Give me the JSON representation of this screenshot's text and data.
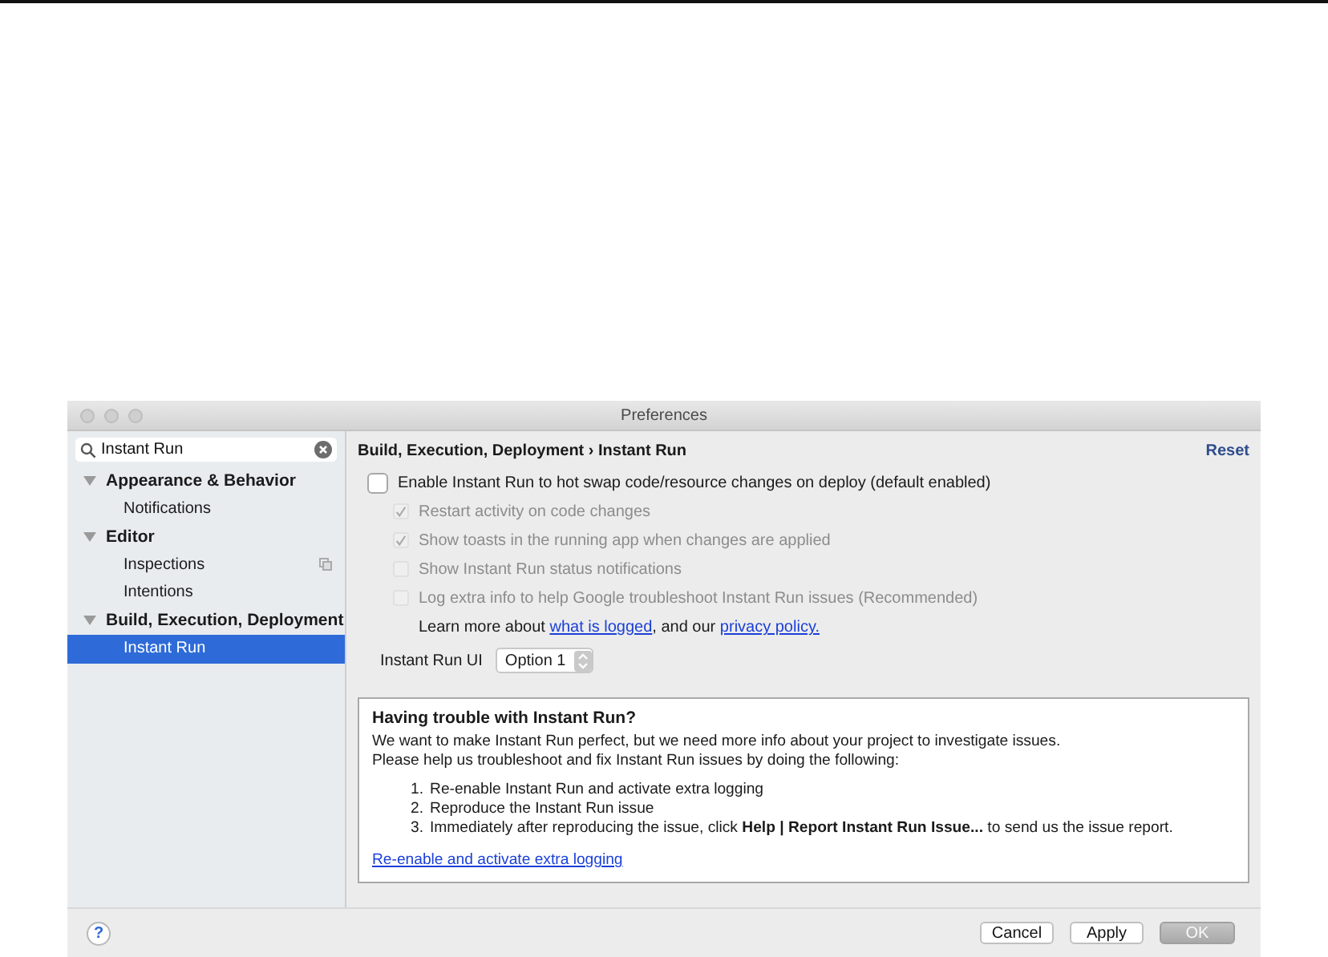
{
  "window": {
    "title": "Preferences"
  },
  "search": {
    "value": "Instant Run"
  },
  "sidebar": {
    "items": [
      {
        "label": "Appearance & Behavior",
        "expanded": true,
        "selected": false,
        "children": [
          {
            "label": "Notifications",
            "selected": false,
            "badge": false
          }
        ]
      },
      {
        "label": "Editor",
        "expanded": true,
        "selected": false,
        "children": [
          {
            "label": "Inspections",
            "selected": false,
            "badge": true
          },
          {
            "label": "Intentions",
            "selected": false,
            "badge": false
          }
        ]
      },
      {
        "label": "Build, Execution, Deployment",
        "expanded": true,
        "selected": false,
        "children": [
          {
            "label": "Instant Run",
            "selected": true,
            "badge": false
          }
        ]
      }
    ]
  },
  "breadcrumb": "Build, Execution, Deployment › Instant Run",
  "reset": "Reset",
  "options": [
    {
      "kind": "main",
      "label": "Enable Instant Run to hot swap code/resource changes on deploy (default enabled)",
      "checked": false,
      "disabled": false
    },
    {
      "kind": "sub",
      "label": "Restart activity on code changes",
      "checked": true,
      "disabled": true
    },
    {
      "kind": "sub",
      "label": "Show toasts in the running app when changes are applied",
      "checked": true,
      "disabled": true
    },
    {
      "kind": "sub",
      "label": "Show Instant Run status notifications",
      "checked": false,
      "disabled": true
    },
    {
      "kind": "sub",
      "label": "Log extra info to help Google troubleshoot Instant Run issues (Recommended)",
      "checked": false,
      "disabled": true
    }
  ],
  "learn_more": {
    "before": "Learn more about ",
    "link1": "what is logged",
    "middle": ", and our ",
    "link2": "privacy policy."
  },
  "ui_select": {
    "label": "Instant Run UI",
    "value": "Option 1"
  },
  "trouble": {
    "title": "Having trouble with Instant Run?",
    "lines": [
      "We want to make Instant Run perfect, but we need more info about your project to investigate issues.",
      "Please help us troubleshoot and fix Instant Run issues by doing the following:"
    ],
    "steps": [
      {
        "number": "1.",
        "text": "Re-enable Instant Run and activate extra logging"
      },
      {
        "number": "2.",
        "text": "Reproduce the Instant Run issue"
      },
      {
        "number": "3.",
        "text": "Immediately after reproducing the issue, click **Help | Report Instant Run Issue...** to send us the issue report."
      }
    ],
    "link": "Re-enable and activate extra logging"
  },
  "help": "?",
  "buttons": [
    {
      "label": "Cancel",
      "disabled": false
    },
    {
      "label": "Apply",
      "disabled": false
    },
    {
      "label": "OK",
      "disabled": true
    }
  ]
}
